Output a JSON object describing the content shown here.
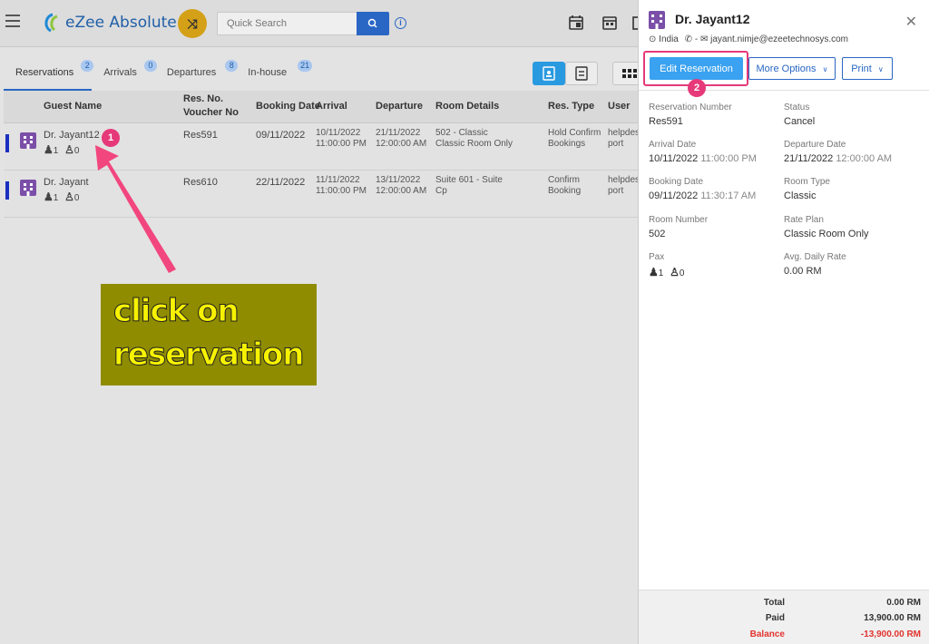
{
  "topbar": {
    "app_name": "eZee Absolute",
    "search_placeholder": "Quick Search"
  },
  "tabs": [
    {
      "label": "Reservations",
      "count": "2"
    },
    {
      "label": "Arrivals",
      "count": "0"
    },
    {
      "label": "Departures",
      "count": "8"
    },
    {
      "label": "In-house",
      "count": "21"
    }
  ],
  "table": {
    "headers": {
      "guest_name": "Guest Name",
      "res_no_1": "Res. No.",
      "res_no_2": "Voucher No",
      "booking_date": "Booking Date",
      "arrival": "Arrival",
      "departure": "Departure",
      "room_details": "Room Details",
      "res_type": "Res. Type",
      "user": "User"
    },
    "rows": [
      {
        "guest": "Dr. Jayant12",
        "adults": "1",
        "children": "0",
        "res_no": "Res591",
        "booking_date": "09/11/2022",
        "arrival_date": "10/11/2022",
        "arrival_time": "11:00:00 PM",
        "departure_date": "21/11/2022",
        "departure_time": "12:00:00 AM",
        "room_1": "502 - Classic",
        "room_2": "Classic Room Only",
        "type_1": "Hold Confirm",
        "type_2": "Bookings",
        "user_1": "helpdes",
        "user_2": "port"
      },
      {
        "guest": "Dr. Jayant",
        "adults": "1",
        "children": "0",
        "res_no": "Res610",
        "booking_date": "22/11/2022",
        "arrival_date": "11/11/2022",
        "arrival_time": "11:00:00 PM",
        "departure_date": "13/11/2022",
        "departure_time": "12:00:00 AM",
        "room_1": "Suite 601 - Suite",
        "room_2": "Cp",
        "type_1": "Confirm",
        "type_2": "Booking",
        "user_1": "helpdes",
        "user_2": "port"
      }
    ]
  },
  "annotation": {
    "line1": "click on",
    "line2": "reservation",
    "step1": "1",
    "step2": "2"
  },
  "panel": {
    "title": "Dr. Jayant12",
    "country": "India",
    "phone_sep": "-",
    "email": "jayant.nimje@ezeetechnosys.com",
    "buttons": {
      "edit": "Edit Reservation",
      "more": "More Options",
      "print": "Print"
    },
    "fields": {
      "res_number_label": "Reservation Number",
      "res_number": "Res591",
      "status_label": "Status",
      "status": "Cancel",
      "arrival_label": "Arrival Date",
      "arrival_date": "10/11/2022",
      "arrival_time": "11:00:00 PM",
      "departure_label": "Departure Date",
      "departure_date": "21/11/2022",
      "departure_time": "12:00:00 AM",
      "booking_label": "Booking Date",
      "booking_date": "09/11/2022",
      "booking_time": "11:30:17 AM",
      "room_type_label": "Room Type",
      "room_type": "Classic",
      "room_number_label": "Room Number",
      "room_number": "502",
      "rate_plan_label": "Rate Plan",
      "rate_plan": "Classic Room Only",
      "pax_label": "Pax",
      "pax_adults": "1",
      "pax_children": "0",
      "adr_label": "Avg. Daily Rate",
      "adr": "0.00 RM"
    },
    "footer": {
      "total_label": "Total",
      "total": "0.00 RM",
      "paid_label": "Paid",
      "paid": "13,900.00 RM",
      "balance_label": "Balance",
      "balance": "-13,900.00 RM"
    }
  },
  "colors": {
    "primary": "#2a66c4",
    "edit_button": "#3aa2f0",
    "annotation_bg": "#8f8c00",
    "annotation_text": "#f7f200",
    "step_marker": "#e6397a",
    "balance": "#e2342f"
  }
}
